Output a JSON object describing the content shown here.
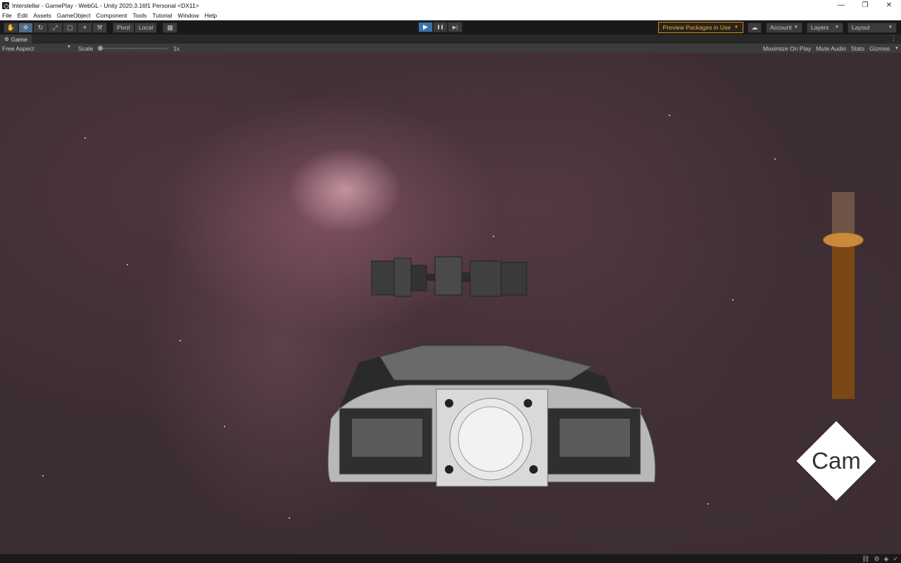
{
  "window": {
    "title": "Interstellar - GamePlay - WebGL - Unity 2020.3.16f1 Personal <DX11>",
    "controls": [
      "—",
      "❐",
      "✕"
    ]
  },
  "menu": [
    "File",
    "Edit",
    "Assets",
    "GameObject",
    "Component",
    "Tools",
    "Tutorial",
    "Window",
    "Help"
  ],
  "toolbar": {
    "tools": [
      {
        "name": "hand-tool-icon",
        "glyph": "✋"
      },
      {
        "name": "move-tool-icon",
        "glyph": "✥"
      },
      {
        "name": "rotate-tool-icon",
        "glyph": "↻"
      },
      {
        "name": "scale-tool-icon",
        "glyph": "⤢"
      },
      {
        "name": "rect-tool-icon",
        "glyph": "▢"
      },
      {
        "name": "transform-tool-icon",
        "glyph": "⌖"
      },
      {
        "name": "custom-tool-icon",
        "glyph": "⚒"
      }
    ],
    "pivot_label": "Pivot",
    "local_label": "Local",
    "grid_glyph": "▦",
    "play_glyph": "▶",
    "pause_glyph": "❚❚",
    "step_glyph": "▶|",
    "preview_packages": "Preview Packages in Use",
    "account": "Account",
    "layers": "Layers",
    "layout": "Layout"
  },
  "game_tab": {
    "label": "Game",
    "aspect": "Free Aspect",
    "scale_label": "Scale",
    "scale_value": "1x",
    "scale_fraction": 0.0,
    "options": [
      "Maximize On Play",
      "Mute Audio",
      "Stats",
      "Gizmos"
    ]
  },
  "game_view": {
    "throttle_fraction": 0.77,
    "cam_button": "Cam"
  },
  "colors": {
    "accent_play": "#3a72b0",
    "preview_border": "#d28a1e",
    "throttle_fill": "#7a4715",
    "throttle_handle": "#c98a3a"
  }
}
